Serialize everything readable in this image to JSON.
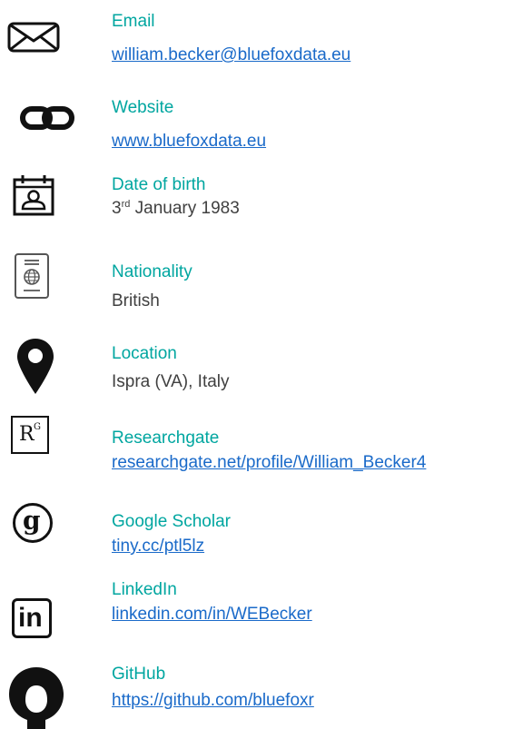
{
  "contacts": {
    "email": {
      "label": "Email",
      "value": "william.becker@bluefoxdata.eu",
      "icon": "envelope-icon"
    },
    "website": {
      "label": "Website",
      "value": "www.bluefoxdata.eu",
      "icon": "link-icon"
    },
    "dob": {
      "label": "Date of birth",
      "day": "3",
      "suffix": "rd",
      "rest": " January 1983",
      "icon": "calendar-icon"
    },
    "nationality": {
      "label": "Nationality",
      "value": "British",
      "icon": "passport-icon"
    },
    "location": {
      "label": "Location",
      "value": "Ispra (VA), Italy",
      "icon": "map-pin-icon"
    },
    "researchgate": {
      "label": "Researchgate",
      "value": "researchgate.net/profile/William_Becker4",
      "icon": "researchgate-icon",
      "glyph": "R",
      "glyph_sup": "G"
    },
    "scholar": {
      "label": "Google Scholar",
      "value": "tiny.cc/ptl5lz",
      "icon": "google-scholar-icon",
      "glyph": "g"
    },
    "linkedin": {
      "label": "LinkedIn",
      "value": "linkedin.com/in/WEBecker",
      "icon": "linkedin-icon",
      "glyph": "in"
    },
    "github": {
      "label": "GitHub",
      "value": "https://github.com/bluefoxr",
      "icon": "github-icon"
    }
  },
  "colors": {
    "label": "#00a6a0",
    "link": "#1a6ac9",
    "text": "#404040",
    "icon": "#111111"
  }
}
